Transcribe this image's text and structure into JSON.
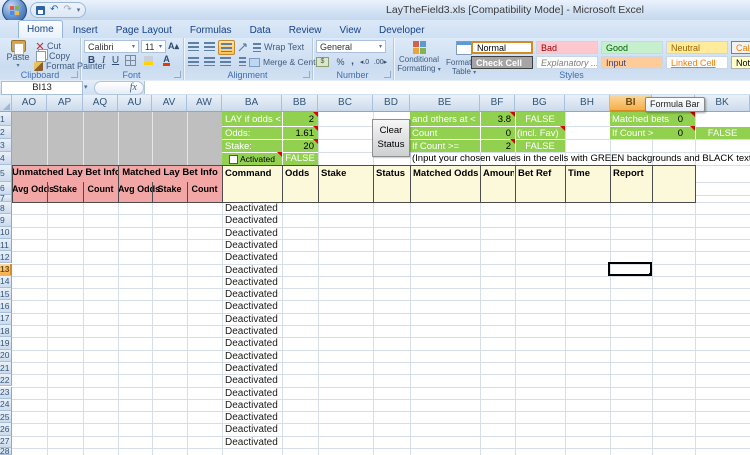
{
  "window": {
    "title": "LayTheField3.xls  [Compatibility Mode] - Microsoft Excel"
  },
  "tabs": {
    "active": "Home",
    "items": [
      "Home",
      "Insert",
      "Page Layout",
      "Formulas",
      "Data",
      "Review",
      "View",
      "Developer"
    ]
  },
  "ribbon": {
    "clipboard": {
      "label": "Clipboard",
      "paste": "Paste",
      "cut": "Cut",
      "copy": "Copy",
      "format_painter": "Format Painter"
    },
    "font": {
      "label": "Font",
      "family": "Calibri",
      "size": "11",
      "bold": "B",
      "italic": "I",
      "underline": "U"
    },
    "alignment": {
      "label": "Alignment",
      "wrap_text": "Wrap Text",
      "merge_center": "Merge & Center"
    },
    "number": {
      "label": "Number",
      "format": "General",
      "percent": "%",
      "comma": ","
    },
    "styles": {
      "label": "Styles",
      "conditional_1": "Conditional",
      "conditional_2": "Formatting",
      "format_1": "Format as",
      "format_2": "Table",
      "gallery": [
        "Normal",
        "Bad",
        "Good",
        "Neutral",
        "Calculation",
        "Check Cell",
        "Explanatory ...",
        "Input",
        "Linked Cell",
        "Note"
      ]
    }
  },
  "formula_bar": {
    "name_box": "BI13",
    "fx": "fx"
  },
  "tooltip": "Formula Bar",
  "sheet": {
    "columns": [
      "AO",
      "AP",
      "AQ",
      "AU",
      "AV",
      "AW",
      "BA",
      "BB",
      "BC",
      "BD",
      "BE",
      "BF",
      "BG",
      "BH",
      "BI",
      "BJ",
      "BK"
    ],
    "selected_column": "BI",
    "selected_row": 13,
    "row_count": 28,
    "config_left": [
      {
        "label": "LAY if odds <",
        "value": "2"
      },
      {
        "label": "Odds:",
        "value": "1.61"
      },
      {
        "label": "Stake:",
        "value": "20"
      }
    ],
    "activated": {
      "label": "Activated",
      "value": "FALSE"
    },
    "config_mid": [
      {
        "label": "and others at <",
        "value": "3.8",
        "extra": "FALSE"
      },
      {
        "label": "Count",
        "value": "0",
        "extra": "(incl. Fav)"
      },
      {
        "label": "If Count >=",
        "value": "2",
        "extra": "FALSE"
      }
    ],
    "config_right": [
      {
        "label": "Matched bets",
        "value": "0",
        "extra": ""
      },
      {
        "label": "If Count >",
        "value": "0",
        "extra": "FALSE"
      }
    ],
    "clear_button": [
      "Clear",
      "Status"
    ],
    "note": "(Input your chosen values in the cells with GREEN backgrounds and BLACK text)",
    "unmatched_title": "Unmatched Lay Bet Info",
    "matched_title": "Matched Lay Bet Info",
    "pink_sub_headers": [
      "Avg Odds",
      "Stake",
      "Count",
      "Avg Odds",
      "Stake",
      "Count"
    ],
    "table_headers": [
      "Command",
      "Odds",
      "Stake",
      "Status",
      "Matched Odds",
      "Amount Matched",
      "Bet Ref",
      "Time",
      "Report"
    ],
    "command_rows": [
      "Deactivated",
      "Deactivated",
      "Deactivated",
      "Deactivated",
      "Deactivated",
      "Deactivated",
      "Deactivated",
      "Deactivated",
      "Deactivated",
      "Deactivated",
      "Deactivated",
      "Deactivated",
      "Deactivated",
      "Deactivated",
      "Deactivated",
      "Deactivated",
      "Deactivated",
      "Deactivated",
      "Deactivated",
      "Deactivated"
    ]
  },
  "colors": {
    "green": "#92D050",
    "pink": "#F2A6A6",
    "cream": "#FCF9DB",
    "gray_block": "#BFBFBF",
    "selection_orange": "#F9C978",
    "grid_line": "#D6DEE8",
    "dark_border": "#4D4D4D"
  }
}
